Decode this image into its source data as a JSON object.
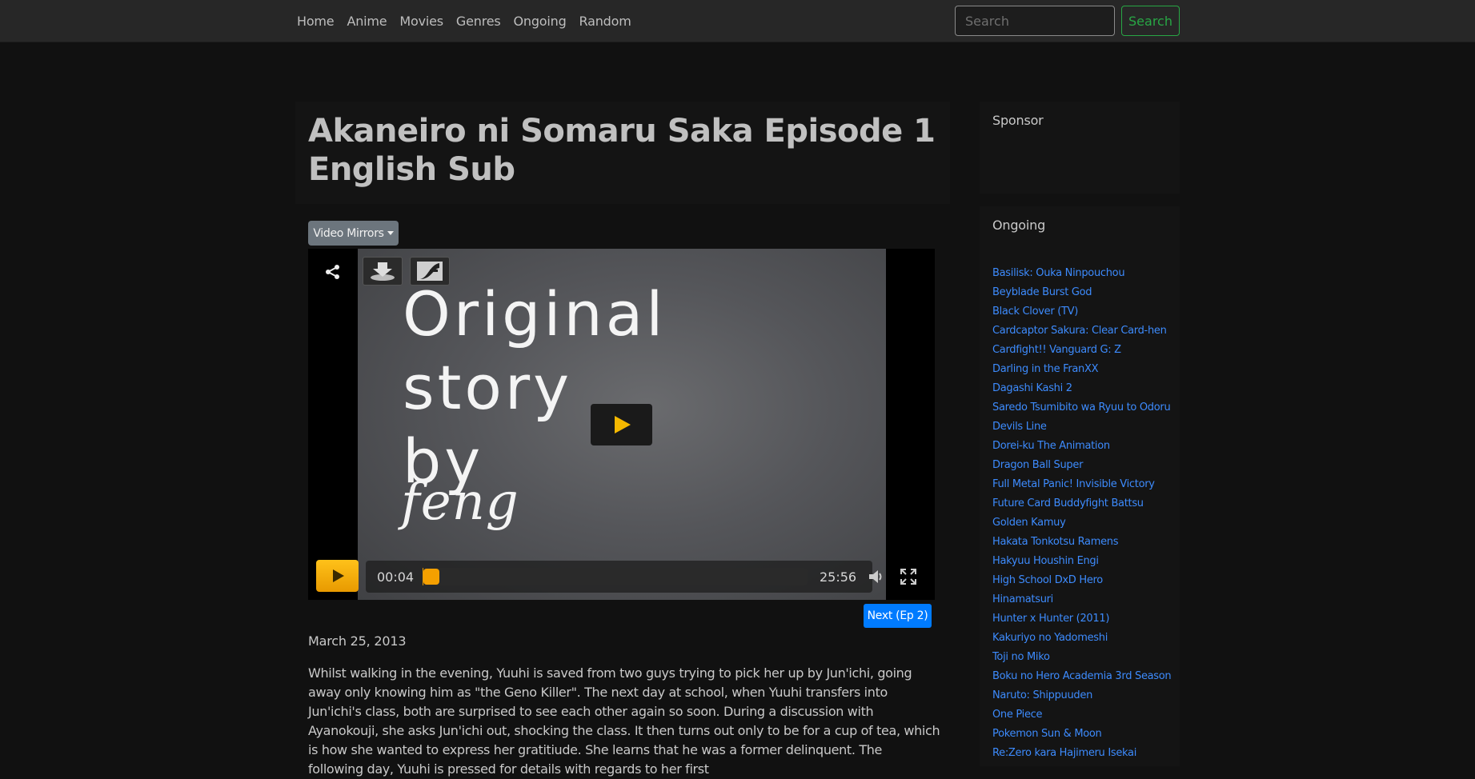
{
  "nav": {
    "items": [
      {
        "label": "Home"
      },
      {
        "label": "Anime"
      },
      {
        "label": "Movies"
      },
      {
        "label": "Genres"
      },
      {
        "label": "Ongoing"
      },
      {
        "label": "Random"
      }
    ],
    "search_placeholder": "Search",
    "search_button": "Search"
  },
  "page": {
    "title": "Akaneiro ni Somaru Saka Episode 1 English Sub",
    "mirrors_label": "Video Mirrors",
    "next_label": "Next (Ep 2)",
    "date": "March 25, 2013",
    "synopsis": "Whilst walking in the evening, Yuuhi is saved from two guys trying to pick her up by Jun'ichi, going away only knowing him as \"the Geno Killer\". The next day at school, when Yuuhi transfers into Jun'ichi's class, both are surprised to see each other again so soon. During a discussion with Ayanokouji, she asks Jun'ichi out, shocking the class. It then turns out only to be for a cup of tea, which is how she wanted to express her gratitiude. She learns that he was a former delinquent. The following day, Yuuhi is pressed for details with regards to her first"
  },
  "player": {
    "frame_text": [
      "Original",
      "story",
      "by"
    ],
    "frame_signature": "feng",
    "current_time": "00:04",
    "total_time": "25:56",
    "progress": 0.003,
    "accent": "#f5a000",
    "icons": [
      "share-icon",
      "download-icon",
      "flash-icon",
      "play-icon",
      "volume-icon",
      "fullscreen-icon"
    ]
  },
  "sidebar": {
    "sponsor_heading": "Sponsor",
    "ongoing_heading": "Ongoing",
    "ongoing": [
      "Basilisk: Ouka Ninpouchou",
      "Beyblade Burst God",
      "Black Clover (TV)",
      "Cardcaptor Sakura: Clear Card-hen",
      "Cardfight!! Vanguard G: Z",
      "Darling in the FranXX",
      "Dagashi Kashi 2",
      "Saredo Tsumibito wa Ryuu to Odoru",
      "Devils Line",
      "Dorei-ku The Animation",
      "Dragon Ball Super",
      "Full Metal Panic! Invisible Victory",
      "Future Card Buddyfight Battsu",
      "Golden Kamuy",
      "Hakata Tonkotsu Ramens",
      "Hakyuu Houshin Engi",
      "High School DxD Hero",
      "Hinamatsuri",
      "Hunter x Hunter (2011)",
      "Kakuriyo no Yadomeshi",
      "Toji no Miko",
      "Boku no Hero Academia 3rd Season",
      "Naruto: Shippuuden",
      "One Piece",
      "Pokemon Sun & Moon",
      "Re:Zero kara Hajimeru Isekai"
    ]
  },
  "colors": {
    "link": "#3d8bfd",
    "success": "#28a745",
    "primary": "#007bff",
    "secondary": "#6c757d"
  }
}
